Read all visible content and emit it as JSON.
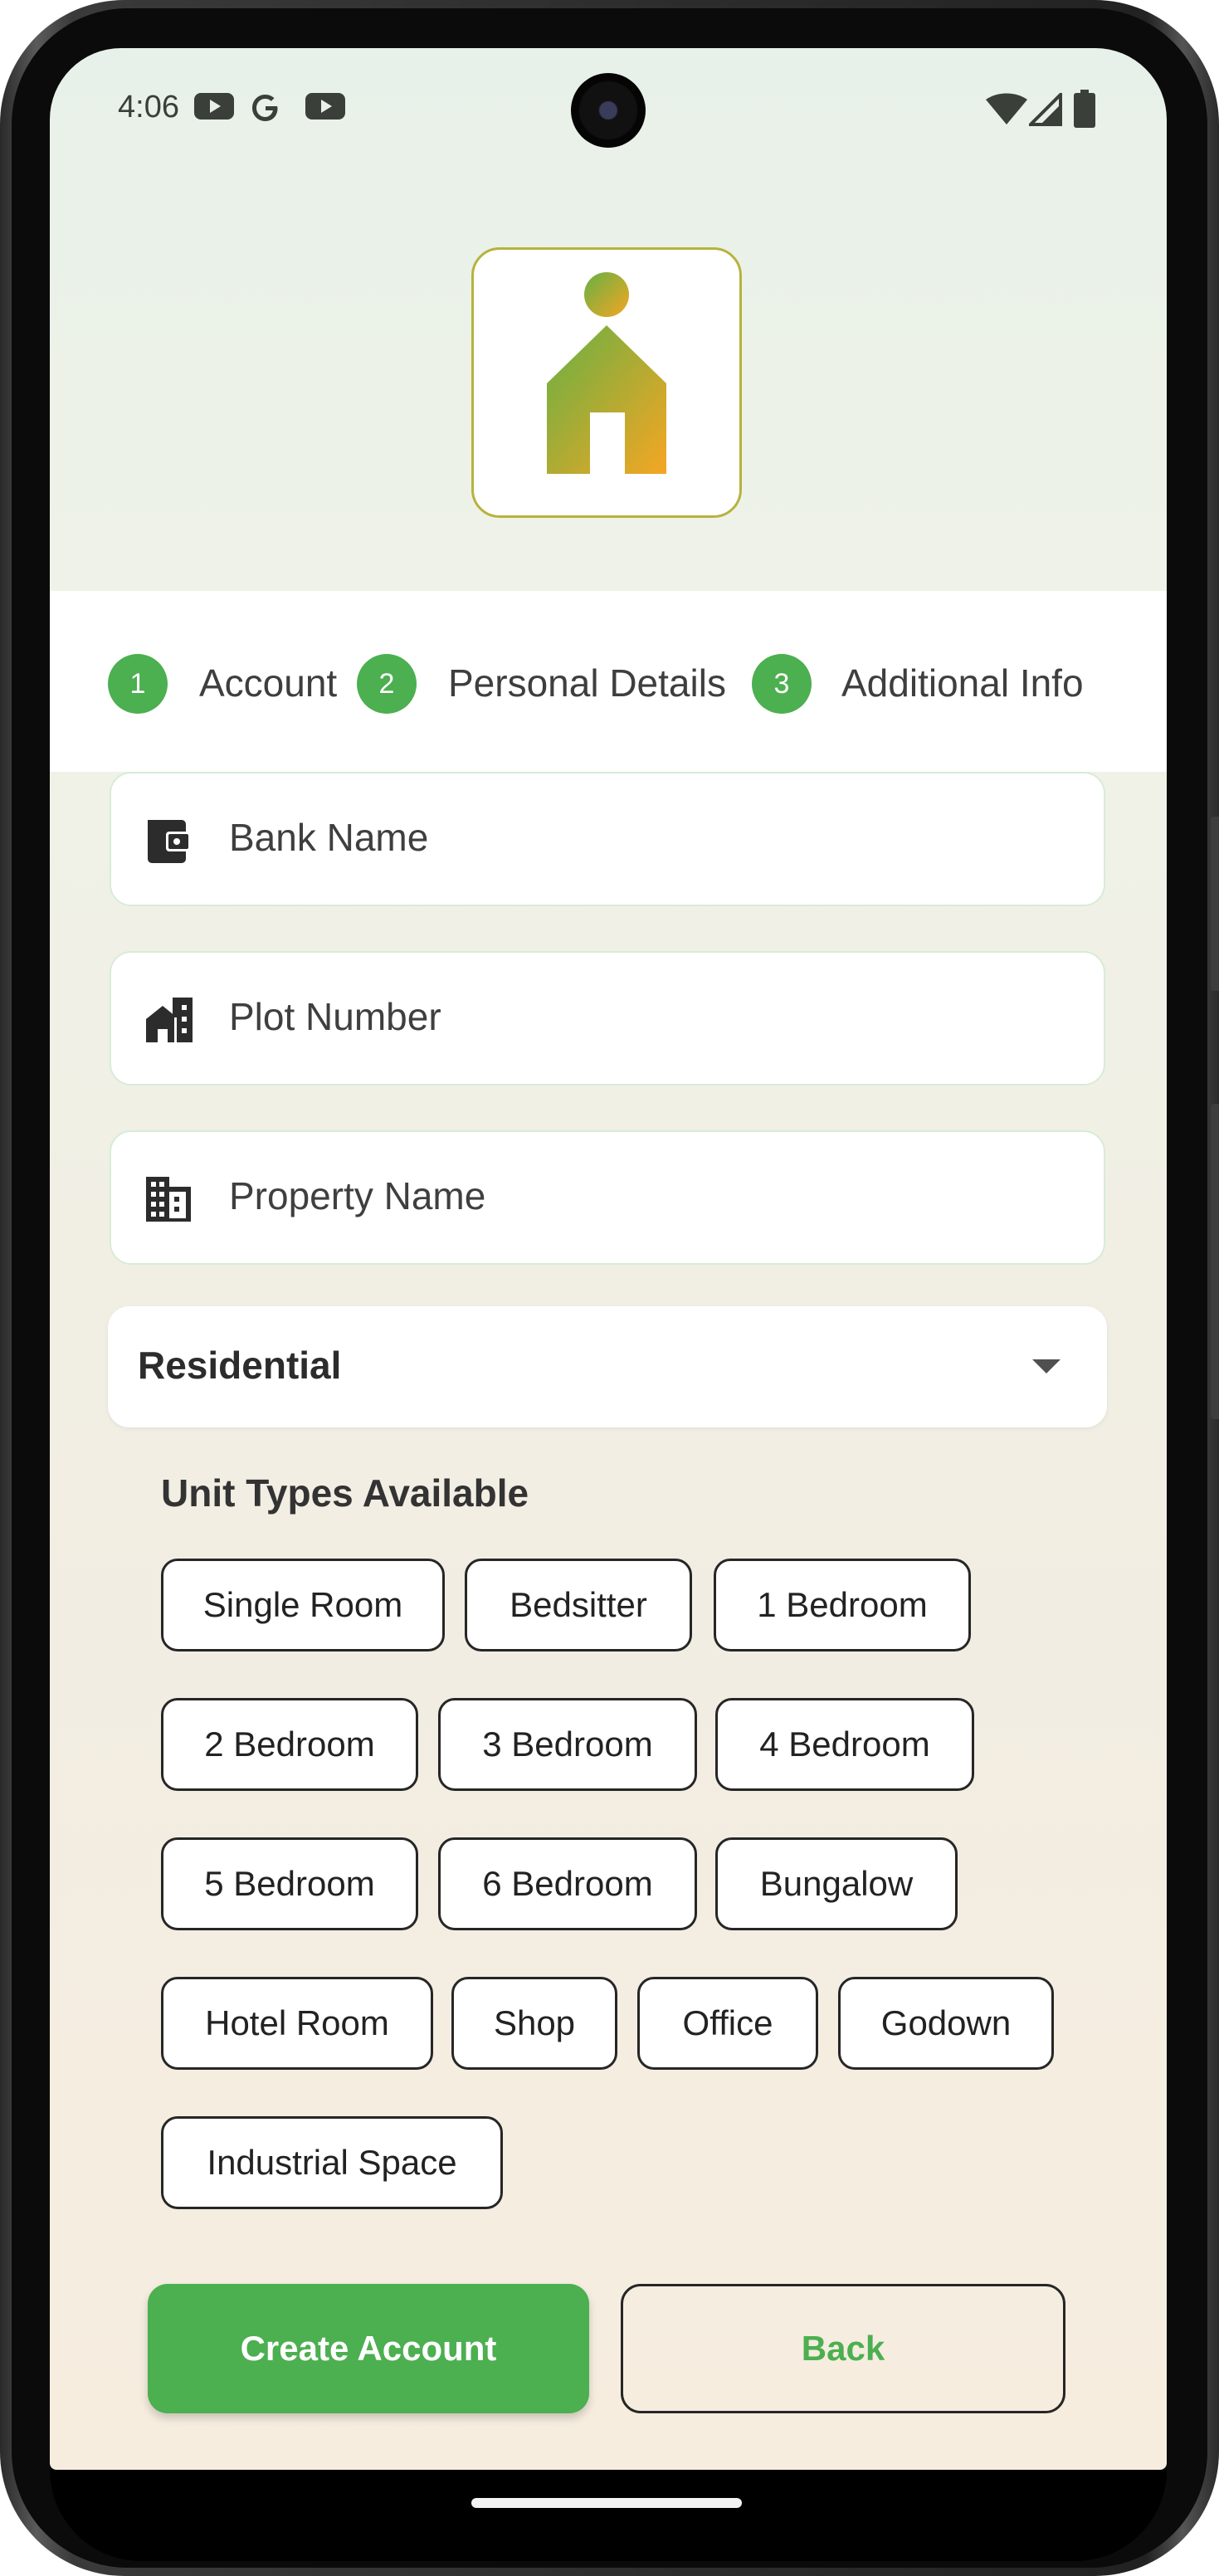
{
  "status_bar": {
    "time": "4:06",
    "left_icons": [
      "youtube-icon",
      "google-icon",
      "youtube-icon"
    ],
    "right_icons": [
      "wifi-icon",
      "signal-icon",
      "battery-icon"
    ]
  },
  "logo": {
    "icon": "house-person-icon",
    "colors": [
      "#66b044",
      "#f5a623"
    ]
  },
  "stepper": {
    "steps": [
      {
        "number": "1",
        "label": "Account"
      },
      {
        "number": "2",
        "label": "Personal Details"
      },
      {
        "number": "3",
        "label": "Additional Info"
      }
    ],
    "active_color": "#4caf50"
  },
  "fields": [
    {
      "icon": "wallet-icon",
      "placeholder": "Bank Name"
    },
    {
      "icon": "house-building-icon",
      "placeholder": "Plot Number"
    },
    {
      "icon": "building-icon",
      "placeholder": "Property Name"
    }
  ],
  "property_type": {
    "value": "Residential"
  },
  "unit_types": {
    "title": "Unit Types Available",
    "options": [
      "Single Room",
      "Bedsitter",
      "1 Bedroom",
      "2 Bedroom",
      "3 Bedroom",
      "4 Bedroom",
      "5 Bedroom",
      "6 Bedroom",
      "Bungalow",
      "Hotel Room",
      "Shop",
      "Office",
      "Godown",
      "Industrial Space"
    ]
  },
  "buttons": {
    "create": "Create Account",
    "back": "Back"
  },
  "colors": {
    "accent": "#4caf50"
  }
}
